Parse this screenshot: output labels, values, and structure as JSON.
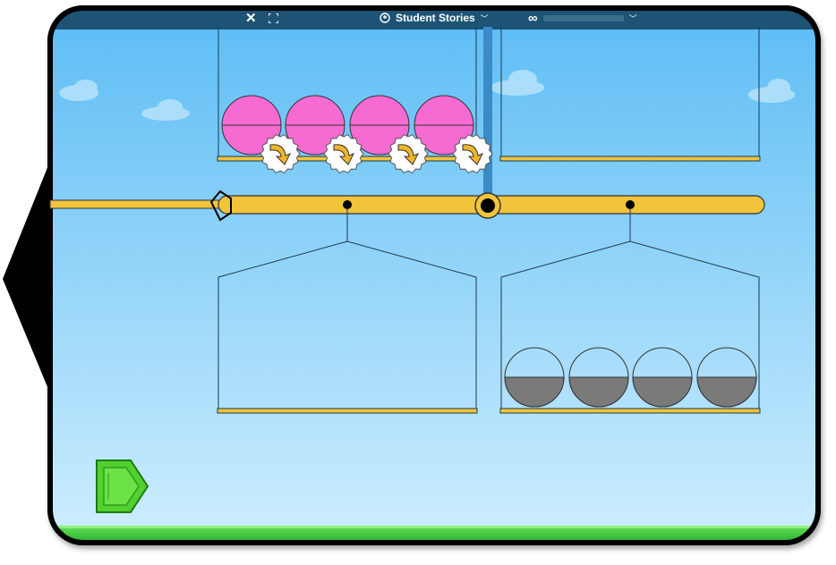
{
  "topbar": {
    "close_icon": "close-icon",
    "fullscreen_icon": "fullscreen-icon",
    "title": "Student Stories",
    "menu_icon": "chevron-down-icon",
    "progress_icon": "infinity-icon",
    "progress": 0
  },
  "scene": {
    "sky_top_color": "#5bbcf5",
    "sky_bottom_color": "#cfeefe",
    "grass_color": "#35c23c",
    "beam_color": "#f2c43b",
    "left_top_hanger": {
      "kind": "pink-circle",
      "count": 4,
      "arrow_badges": 4
    },
    "right_top_hanger": {
      "kind": "empty",
      "count": 0
    },
    "left_bottom_hanger": {
      "kind": "empty",
      "count": 0
    },
    "right_bottom_hanger": {
      "kind": "half-gray-circle",
      "count": 4
    },
    "pink_color": "#f56bd2",
    "gray_color": "#7a7a7a",
    "badge_icon": "curved-arrow-icon",
    "play_button_icon": "play-arrow-icon",
    "play_button_color": "#52d12e"
  }
}
